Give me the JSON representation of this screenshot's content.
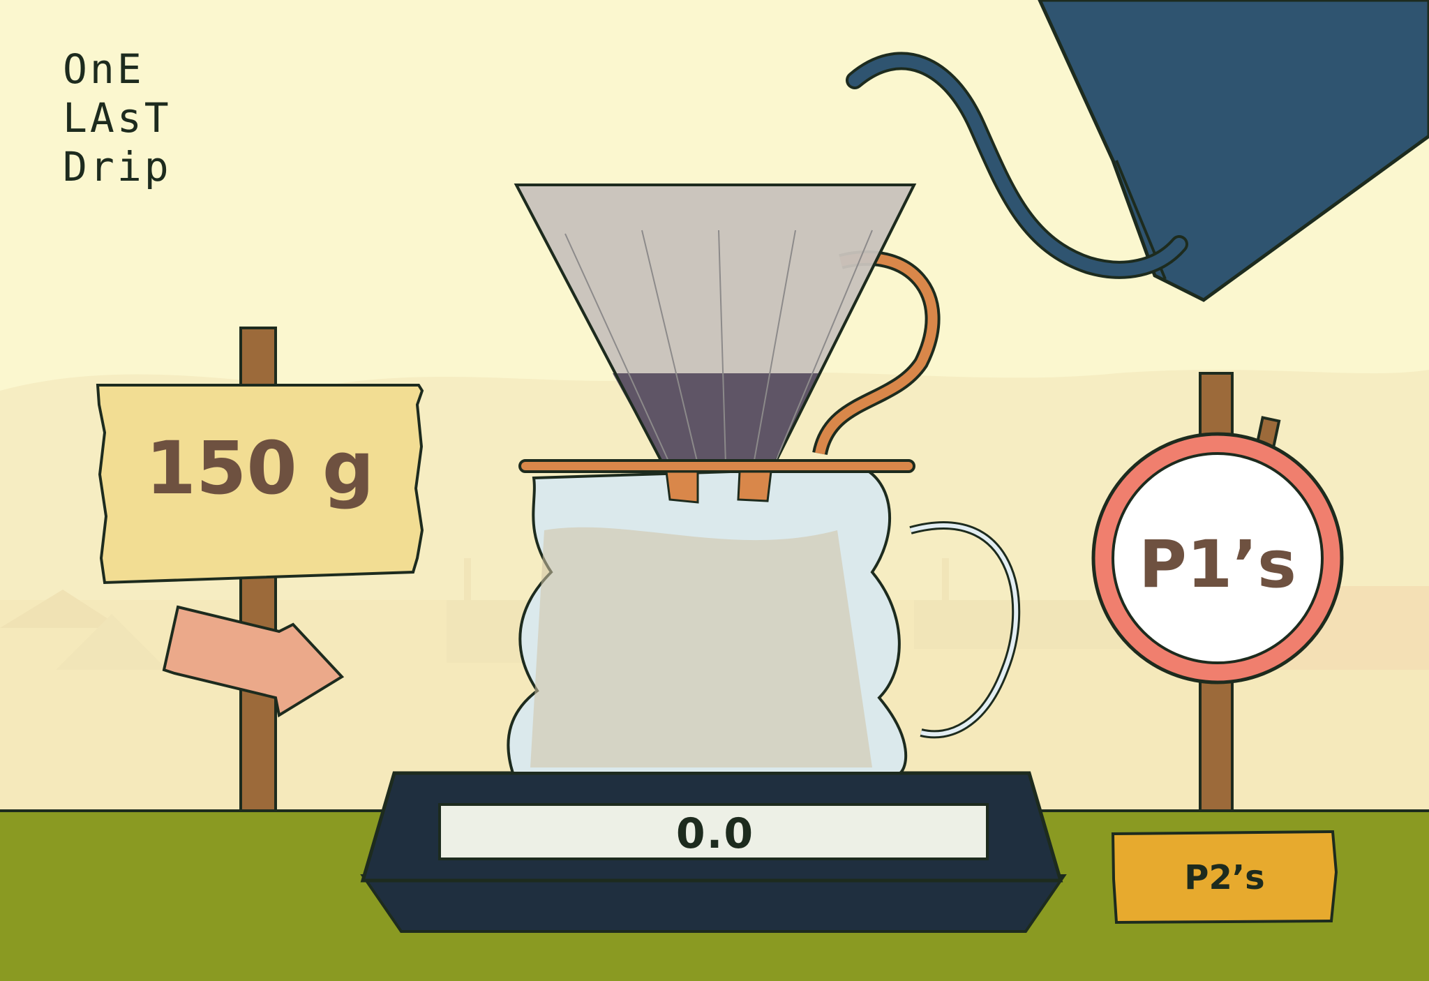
{
  "logo": {
    "line1": "OnE",
    "line2": "LAsT",
    "line3": "Drip"
  },
  "target_sign": {
    "value": "150 g"
  },
  "pour_sign_1": {
    "label": "P1’s"
  },
  "pour_sign_2": {
    "label": "P2’s"
  },
  "scale": {
    "readout": "0.0"
  },
  "colors": {
    "sky": "#fbf7cf",
    "ground": "#8a9a22",
    "kettle": "#2f5470",
    "wood": "#9c6a3a",
    "sign_board": "#f2dd93",
    "arrow": "#eba98a",
    "stop_ring": "#f07f6e",
    "p2_board": "#e7aa2e",
    "scale_body": "#1f2f3f",
    "copper": "#d9874a"
  }
}
